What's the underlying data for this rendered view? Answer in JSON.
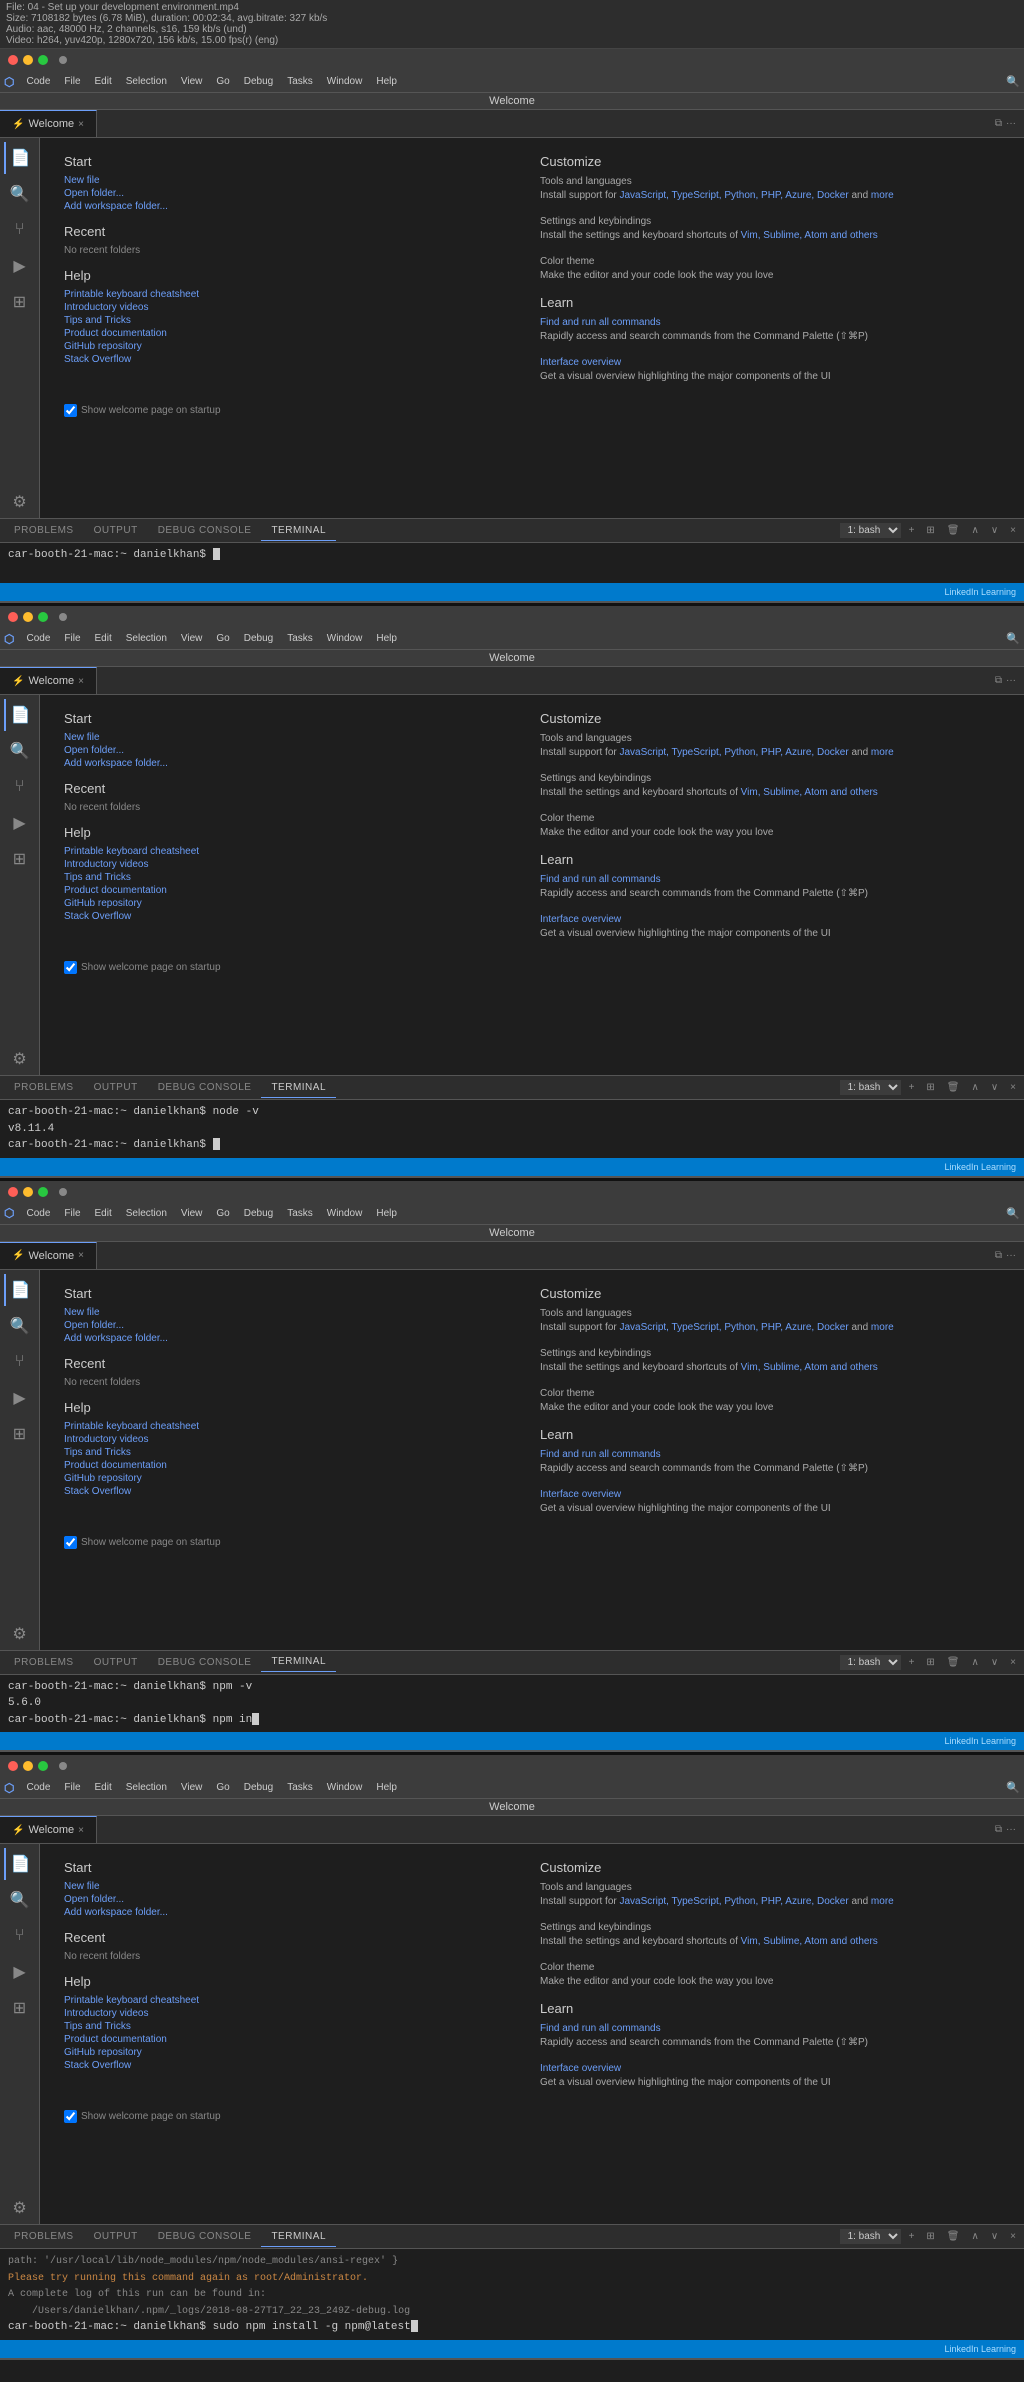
{
  "file_info": {
    "line1": "File: 04 - Set up your development environment.mp4",
    "line2": "Size: 7108182 bytes (6.78 MiB), duration: 00:02:34, avg.bitrate: 327 kb/s",
    "line3": "Audio: aac, 48000 Hz, 2 channels, s16, 159 kb/s (und)",
    "line4": "Video: h264, yuv420p, 1280x720, 156 kb/s, 15.00 fps(r) (eng)"
  },
  "app_title": "Welcome",
  "menu_items": [
    "Code",
    "File",
    "Edit",
    "Selection",
    "View",
    "Go",
    "Debug",
    "Tasks",
    "Window",
    "Help"
  ],
  "tab": {
    "label": "Welcome",
    "close": "×"
  },
  "welcome": {
    "start_title": "Start",
    "new_file": "New file",
    "open_folder": "Open folder...",
    "add_workspace": "Add workspace folder...",
    "recent_title": "Recent",
    "no_recent": "No recent folders",
    "help_title": "Help",
    "help_links": [
      "Printable keyboard cheatsheet",
      "Introductory videos",
      "Tips and Tricks",
      "Product documentation",
      "GitHub repository",
      "Stack Overflow"
    ],
    "customize_title": "Customize",
    "tools_title": "Tools and languages",
    "tools_text": "Install support for ",
    "tools_langs": "JavaScript, TypeScript, Python, PHP, Azure, Docker",
    "tools_and": " and ",
    "tools_more": "more",
    "settings_title": "Settings and keybindings",
    "settings_text": "Install the settings and keyboard shortcuts of ",
    "settings_editors": "Vim, Sublime, Atom and others",
    "color_title": "Color theme",
    "color_text": "Make the editor and your code look the way you love",
    "learn_title": "Learn",
    "find_commands": "Find and run all commands",
    "find_text": "Rapidly access and search commands from the Command Palette (⇧⌘P)",
    "interface_title": "Interface overview",
    "interface_text": "Get a visual overview highlighting the major components of the UI",
    "startup_checkbox": "Show welcome page on startup"
  },
  "panel_tabs": {
    "problems": "PROBLEMS",
    "output": "OUTPUT",
    "debug_console": "DEBUG CONSOLE",
    "terminal": "TERMINAL"
  },
  "terminal_select": "1: bash",
  "panel_buttons": [
    "+",
    "⊞",
    "🗑",
    "∧",
    "∨",
    "×"
  ],
  "instances": [
    {
      "terminal_lines": [
        "car-booth-21-mac:~ danielkhan$ "
      ],
      "has_cursor": true,
      "extra_lines": []
    },
    {
      "terminal_lines": [
        "car-booth-21-mac:~ danielkhan$ node -v",
        "v8.11.4",
        "car-booth-21-mac:~ danielkhan$ "
      ],
      "has_cursor": true,
      "extra_lines": []
    },
    {
      "terminal_lines": [
        "car-booth-21-mac:~ danielkhan$ npm -v",
        "5.6.0",
        "car-booth-21-mac:~ danielkhan$ npm in"
      ],
      "has_cursor": true,
      "extra_lines": []
    },
    {
      "terminal_lines": [
        "path: '/usr/local/lib/node_modules/npm/node_modules/ansi-regex' }",
        "Please try running this command again as root/Administrator.",
        "A complete log of this run can be found in:",
        "    /Users/danielkhan/.npm/_logs/2018-08-27T17_22_23_249Z-debug.log",
        "car-booth-21-mac:~ danielkhan$ sudo npm install -g npm@latest"
      ],
      "has_cursor": true,
      "extra_lines": []
    }
  ],
  "status": {
    "linkedin_text": "LinkedIn Learning"
  },
  "colors": {
    "accent": "#6c9ef8",
    "status_bar": "#007acc",
    "terminal_bg": "#1e1e1e",
    "panel_bg": "#2d2d2d"
  }
}
